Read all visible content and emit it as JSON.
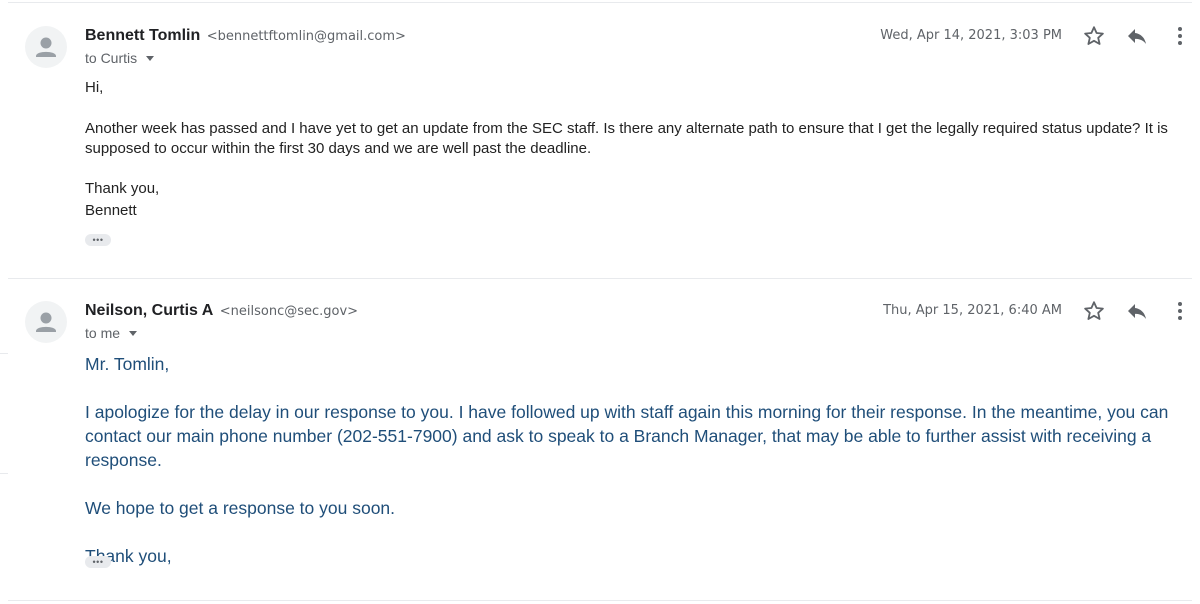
{
  "messages": [
    {
      "sender_name": "Bennett Tomlin",
      "sender_email": "<bennettftomlin@gmail.com>",
      "recipient": "to Curtis",
      "date": "Wed, Apr 14, 2021, 3:03 PM",
      "body": {
        "greeting": "Hi,",
        "paragraph": "Another week has passed and I have yet to get an update from the SEC staff.  Is there any alternate path to ensure that I get the legally required status update? It is supposed to occur within the first 30 days and we are well past the deadline.",
        "closing": "Thank you,",
        "signature": "Bennett"
      },
      "ellipsis": "•••"
    },
    {
      "sender_name": "Neilson, Curtis A",
      "sender_email": "<neilsonc@sec.gov>",
      "recipient": "to me",
      "date": "Thu, Apr 15, 2021, 6:40 AM",
      "body": {
        "greeting": "Mr. Tomlin,",
        "paragraph": "I apologize for the delay in our response to you.  I have followed up with staff again this morning for their response.  In the meantime, you can contact our main phone number (202-551-7900) and ask to speak to a Branch Manager, that may be able to further assist with receiving a response.",
        "paragraph2": "We hope to get a response to you soon.",
        "closing": "Thank you,"
      },
      "ellipsis": "•••"
    }
  ],
  "icons": {
    "star": "star-icon",
    "reply": "reply-icon",
    "more": "more-vert-icon",
    "avatar": "person-avatar-icon"
  },
  "colors": {
    "body_text_1": "#222222",
    "body_text_2": "#1f4e79",
    "secondary_text": "#5f6368",
    "divider": "#e8eaed"
  }
}
